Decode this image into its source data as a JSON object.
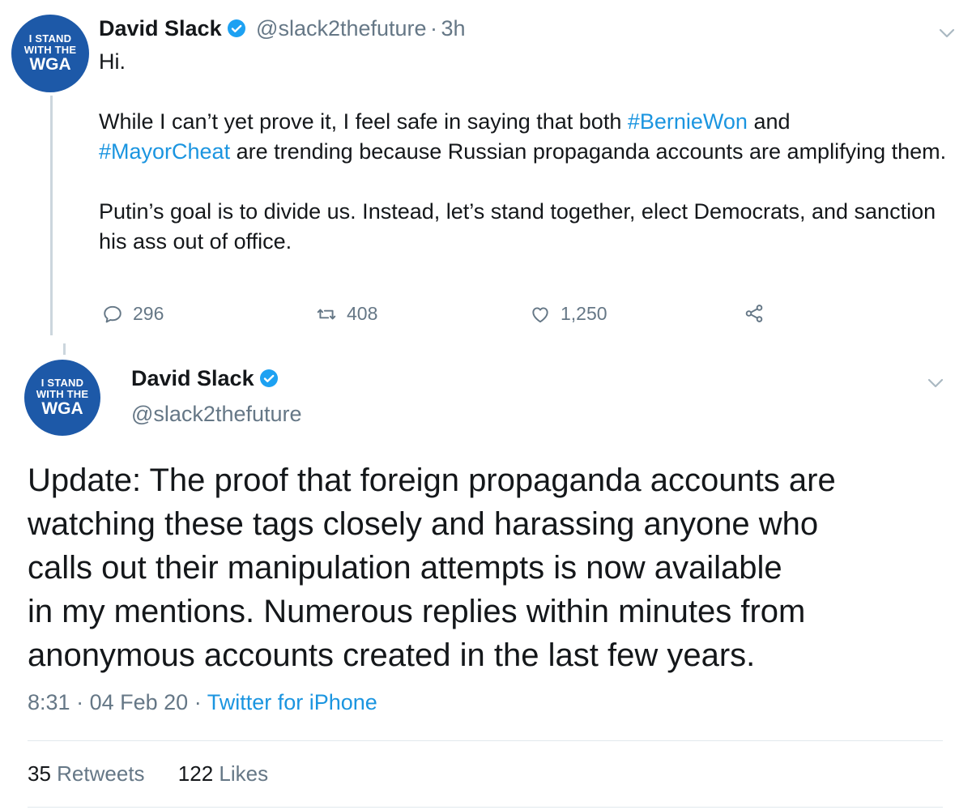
{
  "tweet1": {
    "avatar": {
      "line1": "I STAND",
      "line2": "WITH THE",
      "line3": "WGA"
    },
    "name": "David Slack",
    "handle": "@slack2thefuture",
    "separator": "·",
    "time": "3h",
    "text": {
      "p1": "Hi.",
      "p2_before": "While I can’t yet prove it, I feel safe in saying that both ",
      "hashtag1": "#BernieWon",
      "p2_mid": " and",
      "hashtag2": "#MayorCheat",
      "p2_after": " are trending because Russian propaganda accounts are amplifying them.",
      "p3": "Putin’s goal is to divide us. Instead, let’s stand together, elect Democrats, and sanction his ass out of office."
    },
    "actions": {
      "replies": "296",
      "retweets": "408",
      "likes": "1,250"
    }
  },
  "tweet2": {
    "avatar": {
      "line1": "I STAND",
      "line2": "WITH THE",
      "line3": "WGA"
    },
    "name": "David Slack",
    "handle": "@slack2thefuture",
    "text": {
      "l1": "Update: The proof that foreign propaganda accounts are",
      "l2": "watching these tags closely and harassing anyone who",
      "l3": "calls out their manipulation attempts is now available",
      "l4": "in my mentions. Numerous replies within minutes from",
      "l5": "anonymous accounts created in the last few years."
    },
    "meta": {
      "time": "8:31",
      "dot1": "·",
      "date": "04 Feb 20",
      "dot2": "·",
      "source": "Twitter for iPhone"
    },
    "stats": {
      "retweets_count": "35",
      "retweets_label": "Retweets",
      "likes_count": "122",
      "likes_label": "Likes"
    }
  },
  "colors": {
    "accent": "#1b95e0",
    "secondary": "#657786",
    "avatar": "#1d59a8",
    "verified": "#1da1f2"
  },
  "icons": [
    "verified-badge-icon",
    "chevron-down-icon",
    "reply-icon",
    "retweet-icon",
    "like-icon",
    "share-icon"
  ]
}
